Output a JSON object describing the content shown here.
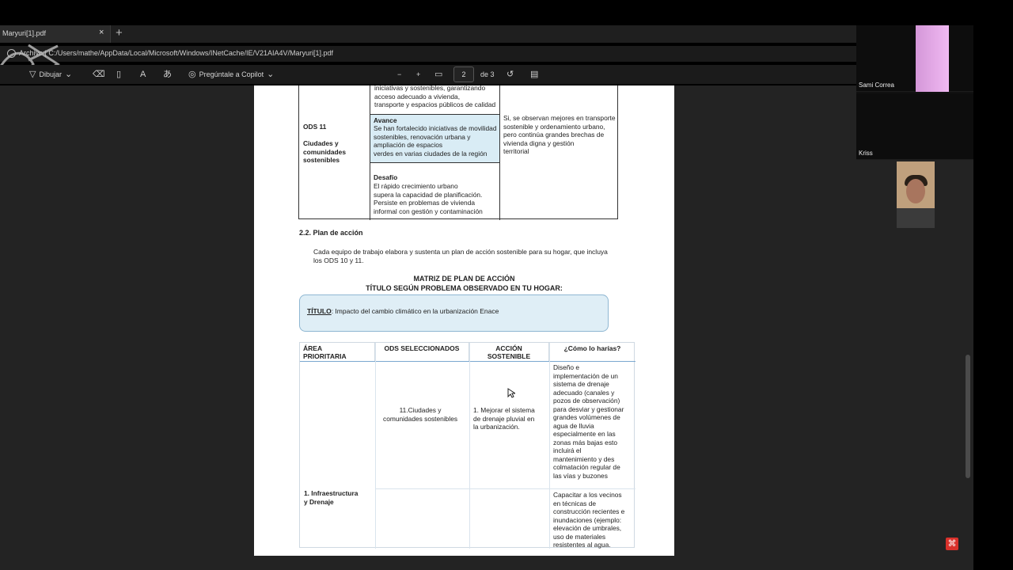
{
  "window": {
    "tab_title": "Maryuri[1].pdf",
    "tab_close": "×",
    "new_tab": "+",
    "address": "Archivo | C:/Users/mathe/AppData/Local/Microsoft/Windows/INetCache/IE/V21AIA4V/Maryuri[1].pdf"
  },
  "toolbar": {
    "draw": "Dibujar",
    "ask_copilot": "Pregúntale a Copilot",
    "minus": "−",
    "plus": "+",
    "page": "2",
    "page_total": "de 3"
  },
  "document": {
    "table1": {
      "ods_label": "ODS 11",
      "ods_title": "Ciudades y\ncomunidades\nsostenibles",
      "top_text": "iniciativas y sostenibles, garantizando\nacceso adecuado a vivienda,\ntransporte y espacios públicos de calidad",
      "avance_title": "Avance",
      "avance_text": "Se han fortalecido iniciativas de movilidad\nsostenibles, renovación urbana y\nampliación de espacios\n verdes en varias ciudades de la región",
      "desafio_title": "Desafío",
      "desafio_text": "El rápido crecimiento urbano\nsupera la capacidad de planificación.\n Persiste en problemas de vivienda\ninformal con gestión y contaminación",
      "right_text": "Si, se observan mejores en transporte\nsostenible y ordenamiento urbano,\npero continúa grandes brechas de\nvivienda digna y gestión\nterritorial"
    },
    "section_title": "2.2. Plan de acción",
    "section_text": "Cada equipo de trabajo elabora y sustenta un plan de acción sostenible para su hogar, que incluya\nlos ODS 10 y 11.",
    "matrix_title": "MATRIZ DE PLAN DE ACCIÓN",
    "matrix_subtitle": "TÍTULO SEGÚN PROBLEMA OBSERVADO EN TU HOGAR:",
    "titulo_label": "TÍTULO",
    "titulo_value": ": Impacto del cambio climático en la urbanización Enace",
    "plan_table": {
      "headers": [
        "ÁREA\nPRIORITARIA",
        "ODS SELECCIONADOS",
        "ACCIÓN\nSOSTENIBLE",
        "¿Cómo lo harías?"
      ],
      "area": "1. Infraestructura\ny Drenaje",
      "ods": "11.Ciudades y\ncomunidades sostenibles",
      "action": "1. Mejorar el sistema\nde drenaje pluvial en\nla urbanización.",
      "how1": "Diseño e\nimplementación de un\nsistema de drenaje\nadecuado (canales y\npozos de observación)\npara desviar y gestionar\ngrandes volúmenes de\nagua de lluvia\nespecialmente en las\nzonas más bajas esto\nincluirá el\nmantenimiento y des\ncolmatación regular de\nlas vías y buzones",
      "how2": "Capacitar a los vecinos\nen técnicas de\nconstrucción recientes e\ninundaciones (ejemplo:\nelevación de umbrales,\nuso de materiales\nresistentes al agua."
    }
  },
  "participants": [
    {
      "name": "Sami Correa"
    },
    {
      "name": "Kriss"
    }
  ]
}
